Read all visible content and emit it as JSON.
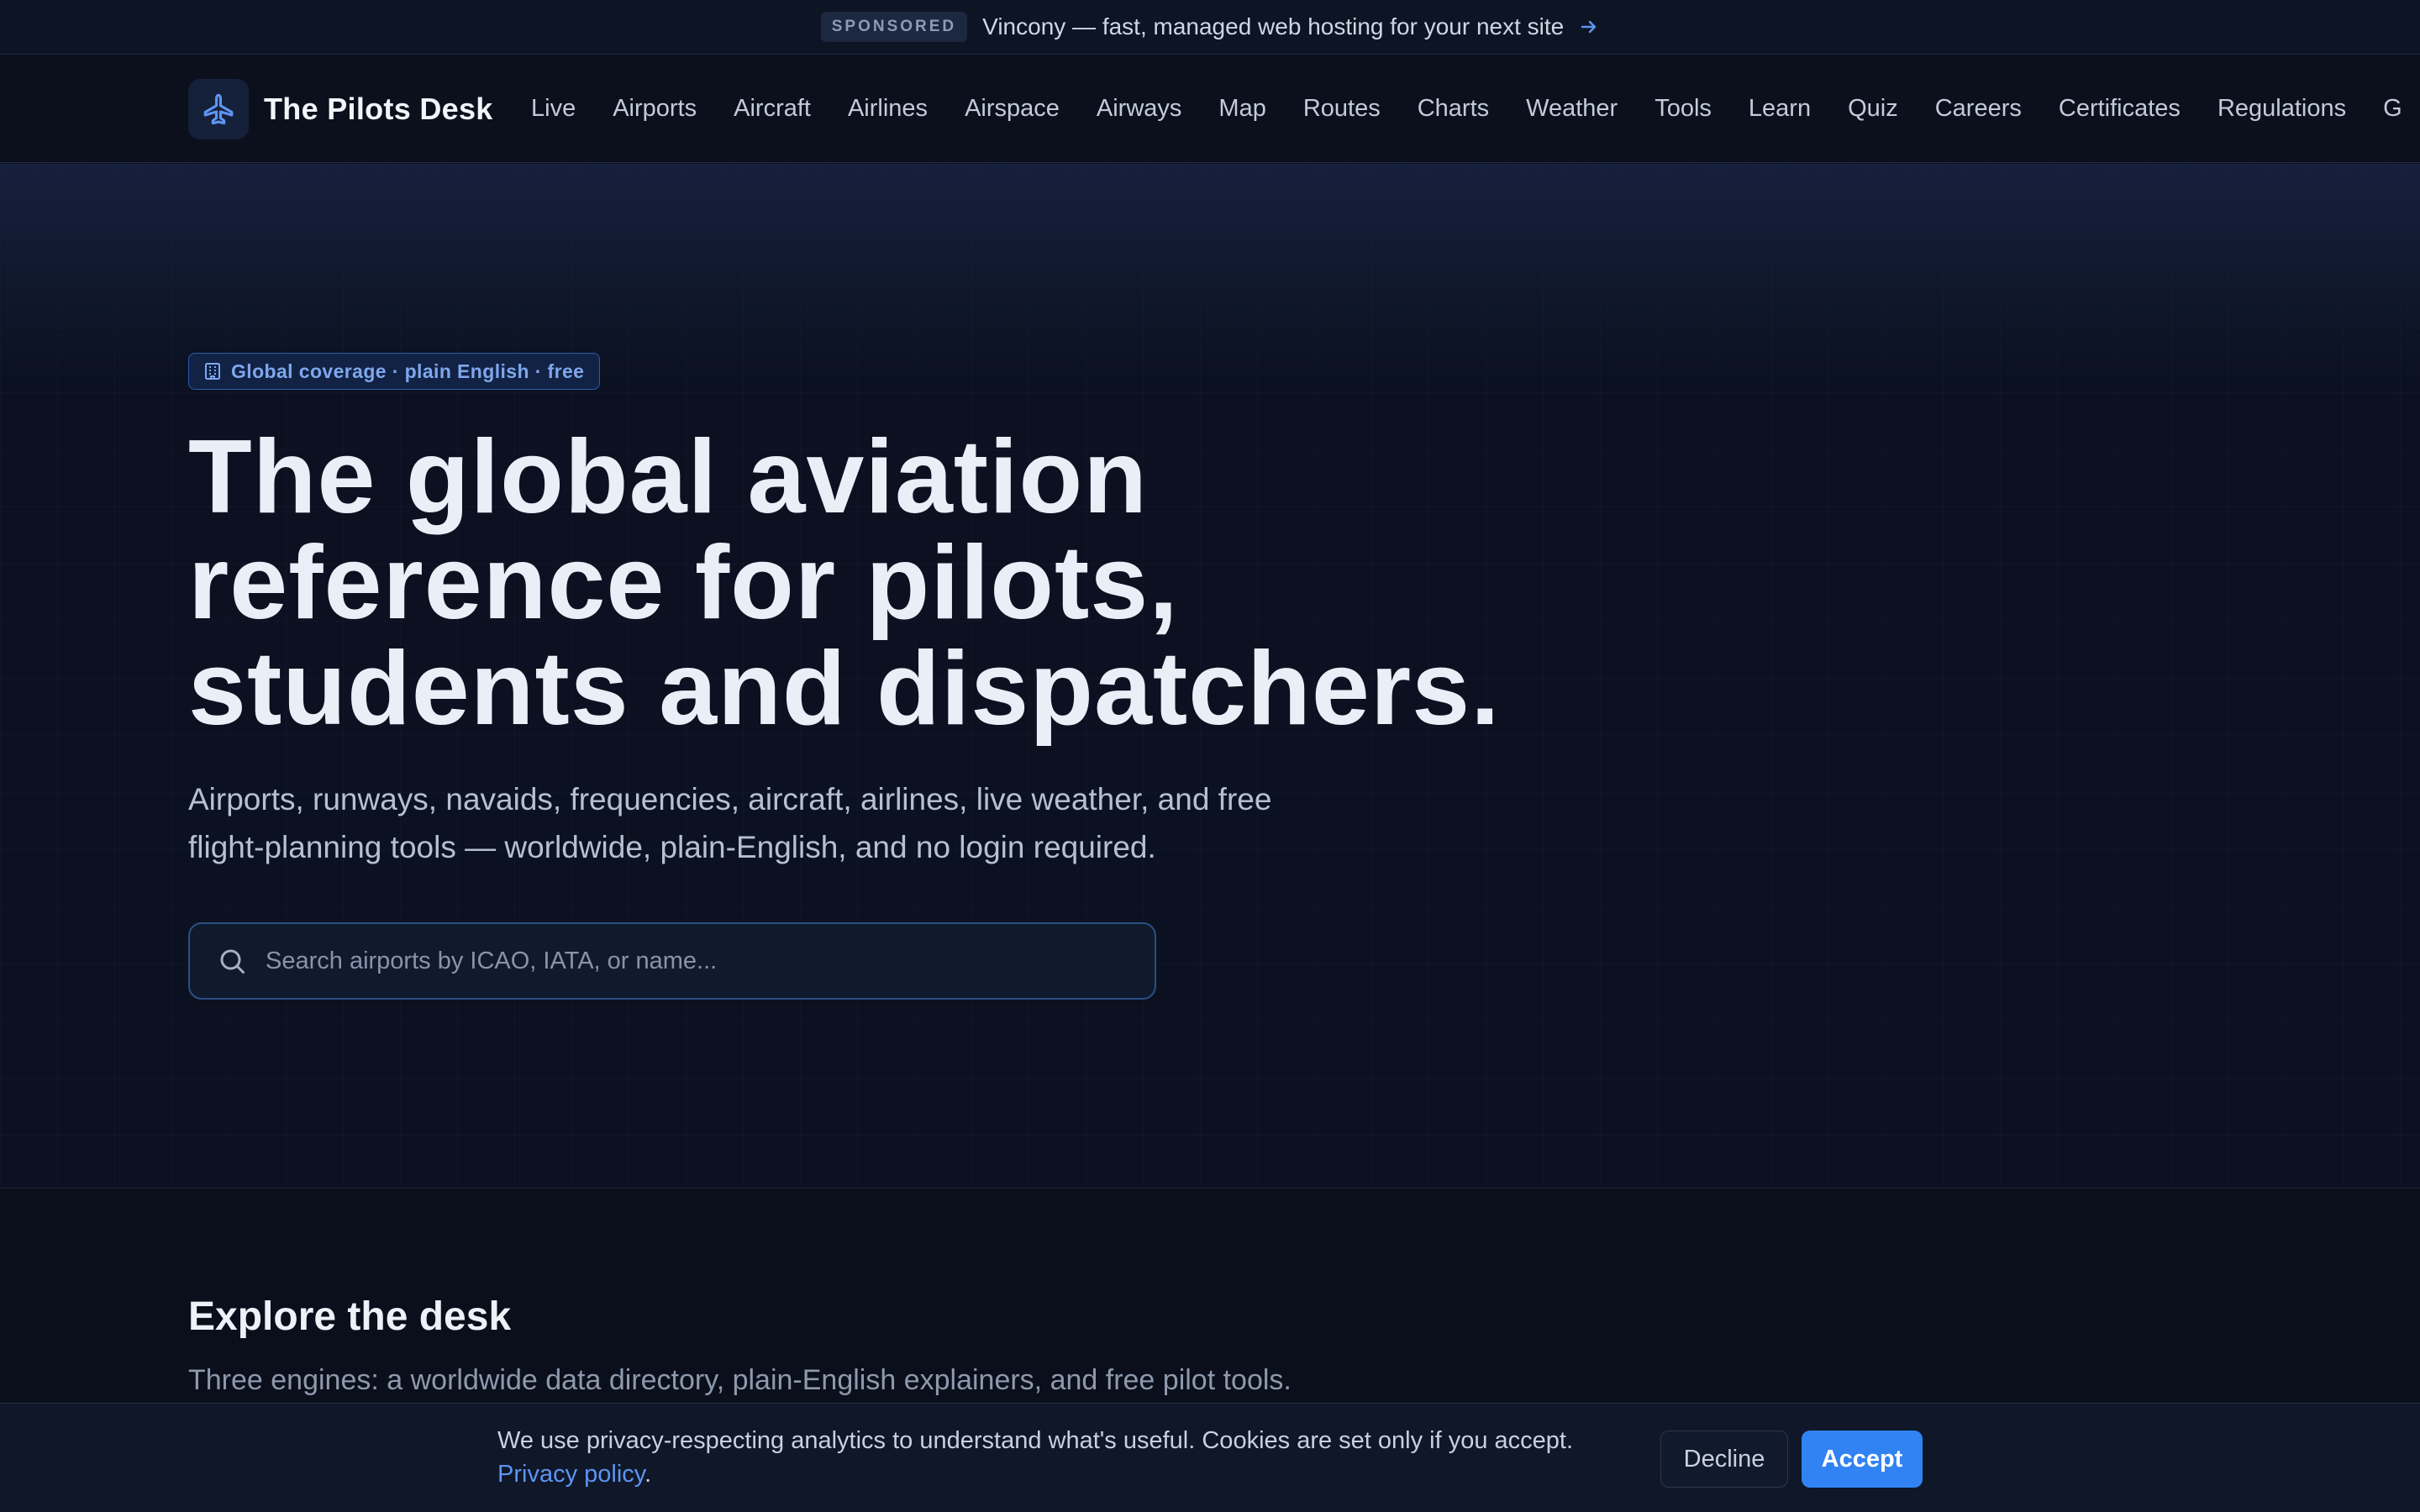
{
  "sponsor": {
    "badge": "SPONSORED",
    "text": "Vincony — fast, managed web hosting for your next site"
  },
  "brand": {
    "name": "The Pilots Desk",
    "icon": "plane-icon"
  },
  "nav": {
    "items": [
      "Live",
      "Airports",
      "Aircraft",
      "Airlines",
      "Airspace",
      "Airways",
      "Map",
      "Routes",
      "Charts",
      "Weather",
      "Tools",
      "Learn",
      "Quiz",
      "Careers",
      "Certificates",
      "Regulations",
      "G"
    ]
  },
  "hero": {
    "badge": "Global coverage · plain English · free",
    "title_lines": [
      "The global aviation",
      "reference for pilots,",
      "students and dispatchers."
    ],
    "subtitle_lines": [
      "Airports, runways, navaids, frequencies, aircraft, airlines, live weather, and free",
      "flight-planning tools — worldwide, plain-English, and no login required."
    ],
    "search_placeholder": "Search airports by ICAO, IATA, or name..."
  },
  "explore": {
    "title": "Explore the desk",
    "subtitle": "Three engines: a worldwide data directory, plain-English explainers, and free pilot tools."
  },
  "cookie": {
    "text": "We use privacy-respecting analytics to understand what's useful. Cookies are set only if you accept.",
    "link": "Privacy policy",
    "link_suffix": ".",
    "decline": "Decline",
    "accept": "Accept"
  },
  "colors": {
    "background": "#0a0f1b",
    "accent": "#3183f4",
    "link": "#5d95f3",
    "badge_text": "#7fa7ec"
  }
}
